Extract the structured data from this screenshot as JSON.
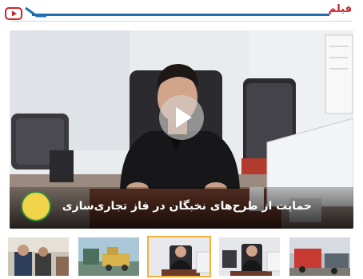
{
  "section": {
    "title": "فیلم",
    "icon": "youtube-play-icon",
    "accent_color": "#d0202a",
    "line_color": "#1f6fb2"
  },
  "featured_video": {
    "caption": "حمایت از طرح‌های نخبگان در فاز تجاری‌سازی",
    "play_icon": "play-icon"
  },
  "thumbnails": [
    {
      "name": "thumbnail-1"
    },
    {
      "name": "thumbnail-2"
    },
    {
      "name": "thumbnail-3",
      "active": true
    },
    {
      "name": "thumbnail-4"
    },
    {
      "name": "thumbnail-5"
    }
  ]
}
